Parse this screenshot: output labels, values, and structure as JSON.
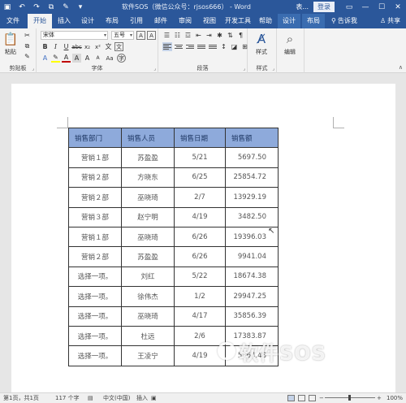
{
  "titlebar": {
    "title": "软件SOS（微信公众号：rjsos666） - Word",
    "context_label": "表...",
    "login": "登录",
    "icons": [
      "save-icon",
      "undo-icon",
      "redo-icon",
      "copy-icon",
      "format-painter-icon",
      "dropdown-icon"
    ],
    "window_controls": [
      "ribbon-display-icon",
      "minimize-icon",
      "maximize-icon",
      "close-icon"
    ]
  },
  "tabs": [
    {
      "label": "文件"
    },
    {
      "label": "开始"
    },
    {
      "label": "插入"
    },
    {
      "label": "设计"
    },
    {
      "label": "布局"
    },
    {
      "label": "引用"
    },
    {
      "label": "邮件"
    },
    {
      "label": "审阅"
    },
    {
      "label": "视图"
    },
    {
      "label": "开发工具"
    },
    {
      "label": "帮助"
    },
    {
      "label": "设计"
    },
    {
      "label": "布局"
    }
  ],
  "tell_me": "告诉我",
  "share": "共享",
  "ribbon": {
    "clipboard": {
      "paste": "粘贴",
      "label": "剪贴板"
    },
    "font": {
      "name": "宋体",
      "size": "五号",
      "label": "字体",
      "clear": "A",
      "text_box": "A",
      "size_up": "A",
      "size_down": "A",
      "aa": "Aa",
      "wen": "文"
    },
    "paragraph": {
      "label": "段落"
    },
    "styles": {
      "button": "样式",
      "label": "样式"
    },
    "editing": {
      "button": "编辑"
    }
  },
  "table": {
    "headers": [
      "销售部门",
      "销售人员",
      "销售日期",
      "销售额"
    ],
    "rows": [
      [
        "营销１部",
        "苏盈盈",
        "5/21",
        "5697.50"
      ],
      [
        "营销２部",
        "方晓东",
        "6/25",
        "25854.72"
      ],
      [
        "营销２部",
        "巫晓琦",
        "2/7",
        "13929.19"
      ],
      [
        "营销３部",
        "赵宁明",
        "4/19",
        "3482.50"
      ],
      [
        "营销１部",
        "巫晓琦",
        "6/26",
        "19396.03"
      ],
      [
        "营销２部",
        "苏盈盈",
        "6/26",
        "9941.04"
      ],
      [
        "选择一项。",
        "刘红",
        "5/22",
        "18674.38"
      ],
      [
        "选择一项。",
        "徐伟杰",
        "1/2",
        "29947.25"
      ],
      [
        "选择一项。",
        "巫晓琦",
        "4/17",
        "35856.39"
      ],
      [
        "选择一项。",
        "杜远",
        "2/6",
        "17383.87"
      ],
      [
        "选择一项。",
        "王凌宁",
        "4/19",
        "5364.48"
      ]
    ]
  },
  "watermark": "软件SOS",
  "status": {
    "page": "第1页，共1页",
    "words": "117 个字",
    "lang": "中文(中国)",
    "mode": "插入",
    "zoom": "100%"
  }
}
